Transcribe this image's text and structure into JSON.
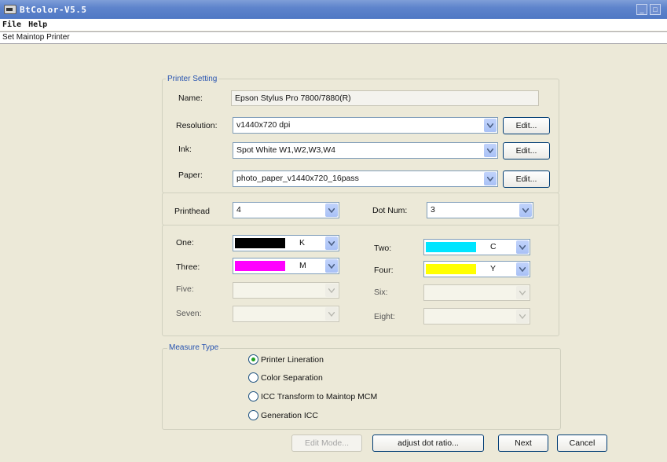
{
  "window": {
    "title": "BtColor-V5.5"
  },
  "menu": {
    "file": "File",
    "help": "Help"
  },
  "subheader": {
    "text": "Set Maintop Printer"
  },
  "printer_setting": {
    "legend": "Printer Setting",
    "name_label": "Name:",
    "name_value": "Epson Stylus Pro 7800/7880(R)",
    "resolution_label": "Resolution:",
    "resolution_value": "v1440x720 dpi",
    "ink_label": "Ink:",
    "ink_value": "Spot White W1,W2,W3,W4",
    "paper_label": "Paper:",
    "paper_value": "photo_paper_v1440x720_16pass",
    "edit_label": "Edit..."
  },
  "printhead": {
    "printhead_label": "Printhead",
    "printhead_value": "4",
    "dotnum_label": "Dot Num:",
    "dotnum_value": "3"
  },
  "channels": {
    "one": {
      "label": "One:",
      "letter": "K",
      "color": "#000000"
    },
    "two": {
      "label": "Two:",
      "letter": "C",
      "color": "#00e5ff"
    },
    "three": {
      "label": "Three:",
      "letter": "M",
      "color": "#ff00ff"
    },
    "four": {
      "label": "Four:",
      "letter": "Y",
      "color": "#ffff00"
    },
    "five": {
      "label": "Five:"
    },
    "six": {
      "label": "Six:"
    },
    "seven": {
      "label": "Seven:"
    },
    "eight": {
      "label": "Eight:"
    }
  },
  "measure": {
    "legend": "Measure Type",
    "options": [
      {
        "label": "Printer Lineration",
        "checked": true
      },
      {
        "label": "Color Separation",
        "checked": false
      },
      {
        "label": "ICC Transform to Maintop MCM",
        "checked": false
      },
      {
        "label": "Generation ICC",
        "checked": false
      }
    ]
  },
  "buttons": {
    "edit_mode": "Edit Mode...",
    "adjust": "adjust dot ratio...",
    "next": "Next",
    "cancel": "Cancel"
  },
  "colors": {
    "titlebar": "#5e84cc",
    "legend": "#2753b0",
    "background": "#ece9d8"
  }
}
